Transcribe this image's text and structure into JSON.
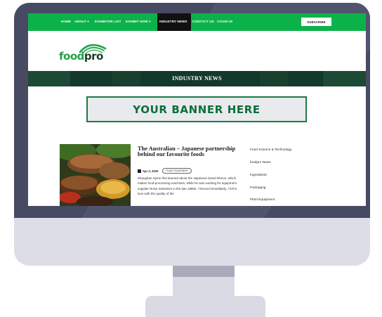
{
  "navbar": {
    "items": [
      "HOME",
      "ABOUT ▾",
      "EXHIBITOR LIST",
      "EXHIBIT NOW ▾",
      "INDUSTRY NEWS",
      "CONTACT US",
      "COVID-19"
    ],
    "subscribe_label": "SUBSCRIBE"
  },
  "logo": {
    "food": "food",
    "pro": "pro"
  },
  "hero": {
    "title": "INDUSTRY NEWS"
  },
  "banner": {
    "text": "YOUR BANNER HERE"
  },
  "article": {
    "title": "The Australian – Japanese partnership behind our favourite foods",
    "date": "Apr 2, 2020",
    "tag": "PLANT EQUIPMENT",
    "body": "Shaughan Syme first learned about the Japanese brand Rheon, which makes food-processing machines, while he was working for equipment supplier Rossi Industries in the late 1980s. “Almost immediately, I fell in love with the quality of the"
  },
  "sidebar": {
    "links": [
      "Food Science & Technology",
      "foodpro News",
      "Ingredients",
      "Packaging",
      "Plant Equipment"
    ]
  },
  "colors": {
    "nav_green": "#0bb24a",
    "hero_dark_green": "#14382a",
    "banner_green": "#0d6e3a",
    "monitor_bezel": "#484a63",
    "monitor_body": "#dcdde6"
  }
}
